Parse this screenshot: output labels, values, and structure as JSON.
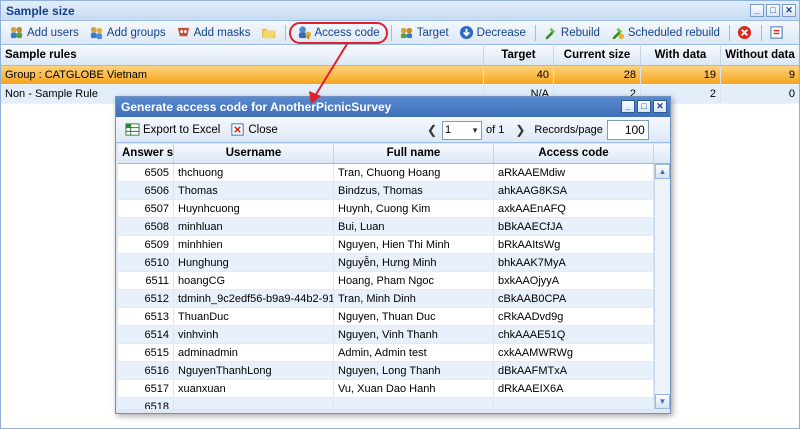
{
  "window": {
    "title": "Sample size"
  },
  "toolbar": {
    "items": [
      {
        "label": "Add users",
        "icon": "add-users-icon"
      },
      {
        "label": "Add groups",
        "icon": "add-groups-icon"
      },
      {
        "label": "Add masks",
        "icon": "add-masks-icon"
      },
      {
        "label": "",
        "icon": "folder-icon"
      },
      {
        "label": "Access code",
        "icon": "access-code-icon"
      },
      {
        "label": "Target",
        "icon": "target-icon"
      },
      {
        "label": "Decrease",
        "icon": "decrease-icon"
      },
      {
        "label": "Rebuild",
        "icon": "rebuild-icon"
      },
      {
        "label": "Scheduled rebuild",
        "icon": "scheduled-rebuild-icon"
      },
      {
        "label": "",
        "icon": "delete-icon"
      },
      {
        "label": "",
        "icon": "export-icon"
      }
    ]
  },
  "grid": {
    "columns": [
      "Sample rules",
      "Target",
      "Current size",
      "With data",
      "Without data"
    ],
    "rows": [
      {
        "name": "Group : CATGLOBE Vietnam",
        "target": "40",
        "current": "28",
        "with": "19",
        "without": "9"
      },
      {
        "name": "Non - Sample Rule",
        "target": "N/A",
        "current": "2",
        "with": "2",
        "without": "0"
      }
    ]
  },
  "dialog": {
    "title": "Generate access code for AnotherPicnicSurvey",
    "export_label": "Export to Excel",
    "close_label": "Close",
    "page_value": "1",
    "of_pages": "of 1",
    "records_label": "Records/page",
    "records_value": "100",
    "columns": [
      "Answer sl",
      "Username",
      "Full name",
      "Access code"
    ],
    "rows": [
      [
        "6505",
        "thchuong",
        "Tran, Chuong Hoang",
        "aRkAAEMdiw"
      ],
      [
        "6506",
        "Thomas",
        "Bindzus, Thomas",
        "ahkAAG8KSA"
      ],
      [
        "6507",
        "Huynhcuong",
        "Huynh, Cuong Kim",
        "axkAAEnAFQ"
      ],
      [
        "6508",
        "minhluan",
        "Bui, Luan",
        "bBkAAECfJA"
      ],
      [
        "6509",
        "minhhien",
        "Nguyen, Hien Thi Minh",
        "bRkAAItsWg"
      ],
      [
        "6510",
        "Hunghung",
        "Nguyễn, Hưng Minh",
        "bhkAAK7MyA"
      ],
      [
        "6511",
        "hoangCG",
        "Hoang, Pham Ngoc",
        "bxkAAOjyyA"
      ],
      [
        "6512",
        "tdminh_9c2edf56-b9a9-44b2-91",
        "Tran, Minh Dinh",
        "cBkAAB0CPA"
      ],
      [
        "6513",
        "ThuanDuc",
        "Nguyen, Thuan Duc",
        "cRkAADvd9g"
      ],
      [
        "6514",
        "vinhvinh",
        "Nguyen, Vinh Thanh",
        "chkAAAE51Q"
      ],
      [
        "6515",
        "adminadmin",
        "Admin, Admin test",
        "cxkAAMWRWg"
      ],
      [
        "6516",
        "NguyenThanhLong",
        "Nguyen, Long Thanh",
        "dBkAAFMTxA"
      ],
      [
        "6517",
        "xuanxuan",
        "Vu, Xuan Dao Hanh",
        "dRkAAEIX6A"
      ],
      [
        "6518",
        "",
        "",
        ""
      ]
    ]
  },
  "colors": {
    "selected_row": "#f6a51c",
    "highlight": "#e0202a",
    "header_text": "#15428b"
  }
}
